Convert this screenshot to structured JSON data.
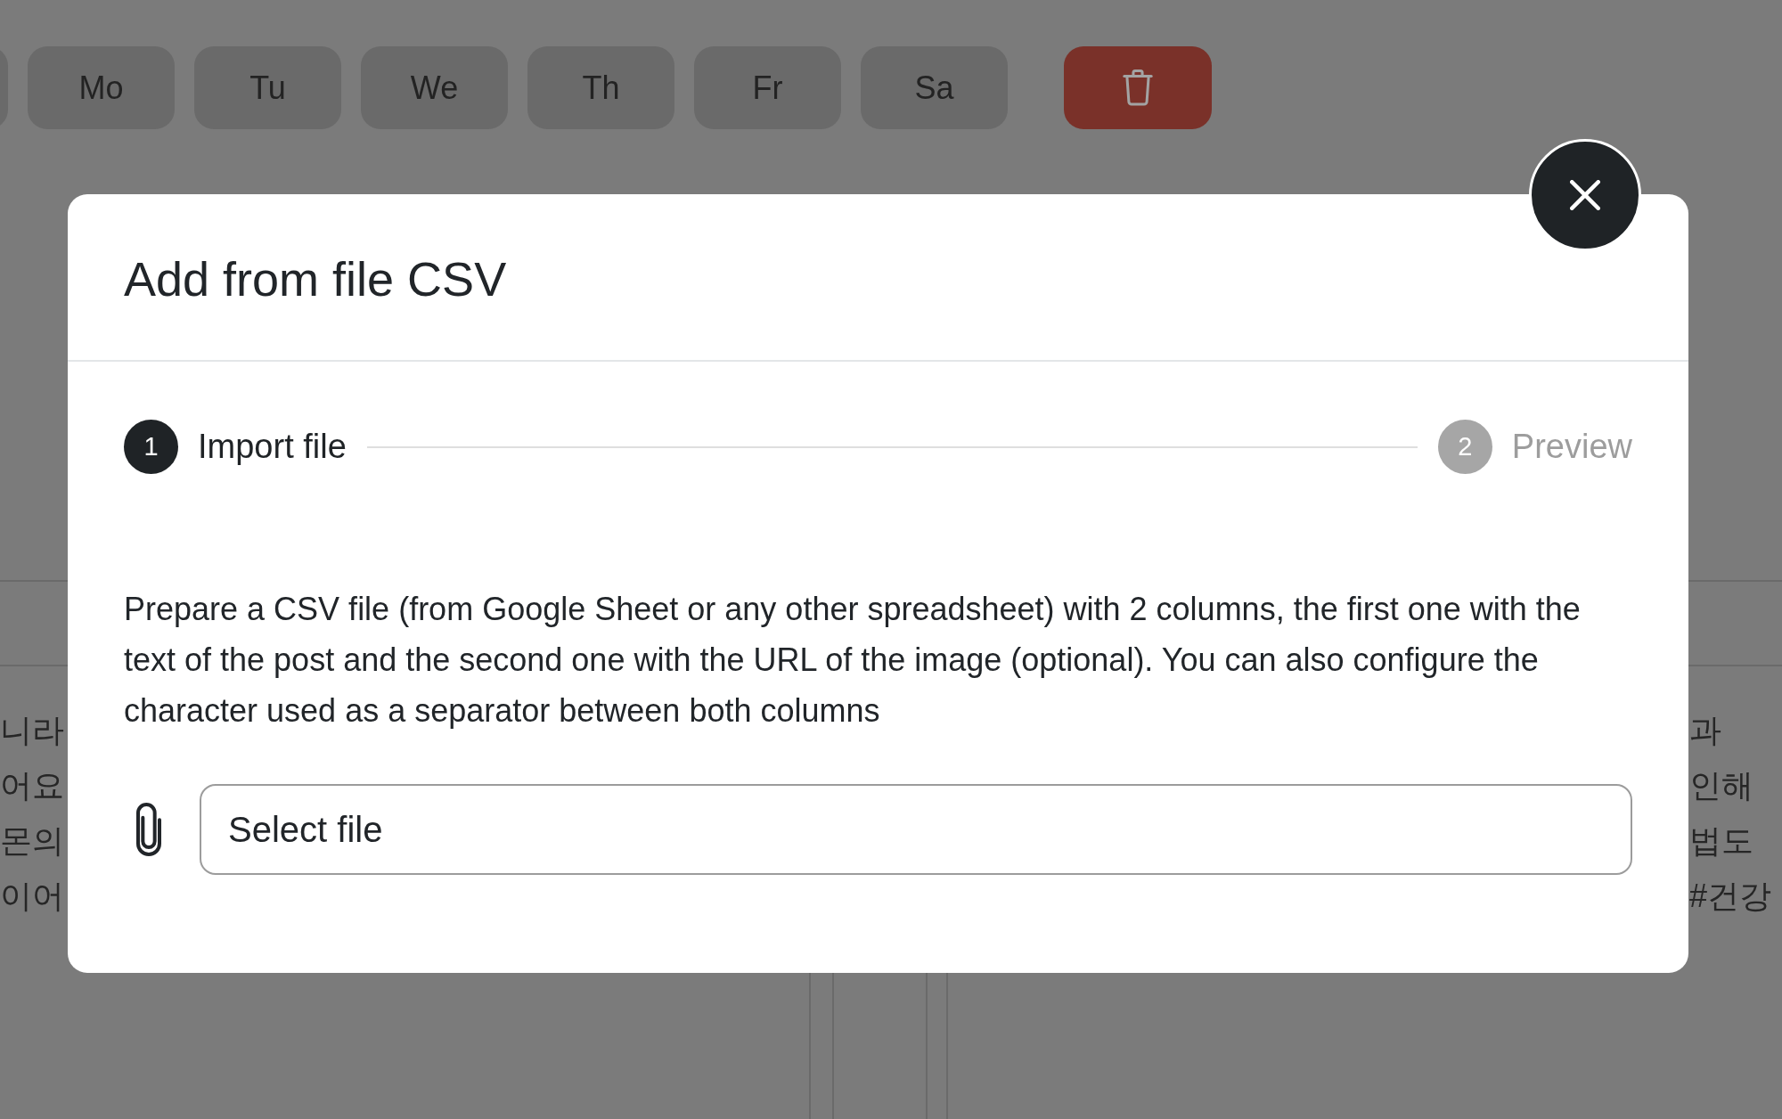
{
  "day_buttons": [
    "Mo",
    "Tu",
    "We",
    "Th",
    "Fr",
    "Sa"
  ],
  "background_cards": {
    "left_text": [
      "니라",
      "어요",
      "몬의",
      "이어"
    ],
    "right_text": [
      "과",
      "인해",
      "법도",
      "#건강"
    ]
  },
  "dialog": {
    "title": "Add from file CSV",
    "steps": [
      {
        "number": "1",
        "label": "Import file",
        "active": true
      },
      {
        "number": "2",
        "label": "Preview",
        "active": false
      }
    ],
    "description": "Prepare a CSV file (from Google Sheet or any other spreadsheet) with 2 columns, the first one with the text of the post and the second one with the URL of the image (optional). You can also configure the character used as a separator between both columns",
    "file_field": {
      "placeholder": "Select file"
    }
  }
}
